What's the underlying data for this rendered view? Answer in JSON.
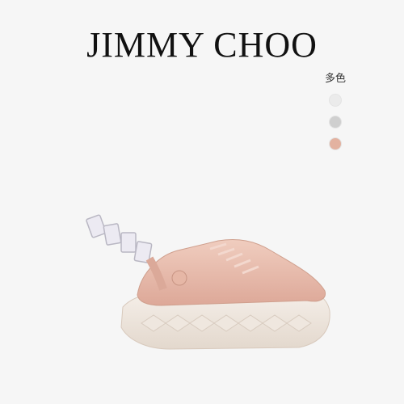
{
  "brand": "JIMMY CHOO",
  "colors_label": "多色",
  "swatches": [
    {
      "name": "white",
      "color": "#ebebeb"
    },
    {
      "name": "silver-glitter",
      "color": "#cfcfcf"
    },
    {
      "name": "blush",
      "color": "#e3b2a0"
    }
  ],
  "product_colors": {
    "upper": "#e9c1b2",
    "upper_shadow": "#d9a896",
    "sole": "#efe7df",
    "crystal": "#e8e6ef"
  }
}
